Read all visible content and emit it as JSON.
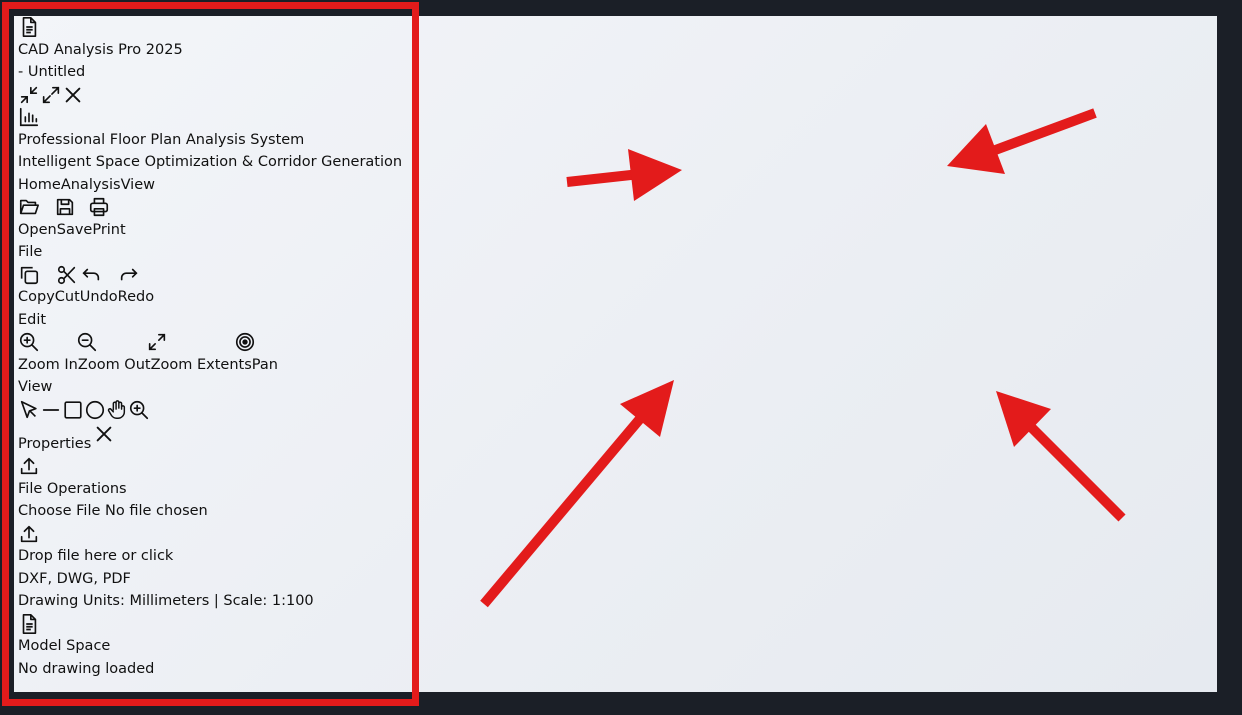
{
  "app": {
    "title": "CAD Analysis Pro 2025",
    "doc_title": "- Untitled"
  },
  "header": {
    "title": "Professional Floor Plan Analysis System",
    "subtitle": "Intelligent Space Optimization & Corridor Generation"
  },
  "tabs": [
    "Home",
    "Analysis",
    "View"
  ],
  "ribbon": {
    "file": {
      "group": "File",
      "buttons": [
        "Open",
        "Save",
        "Print"
      ]
    },
    "edit": {
      "group": "Edit",
      "buttons": [
        "Copy",
        "Cut",
        "Undo",
        "Redo"
      ]
    },
    "view": {
      "group": "View",
      "buttons": [
        "Zoom In",
        "Zoom Out",
        "Zoom Extents",
        "Pan"
      ]
    }
  },
  "tools": [
    "select-icon",
    "line-icon",
    "rectangle-icon",
    "circle-icon",
    "hand-icon",
    "zoom-icon"
  ],
  "properties": {
    "label": "Properties"
  },
  "file_ops": {
    "title": "File Operations",
    "choose_button": "Choose File",
    "no_file": "No file chosen",
    "drop_text": "Drop file here or click",
    "formats": "DXF, DWG, PDF"
  },
  "units": "Drawing Units: Millimeters | Scale: 1:100",
  "model_space": {
    "title": "Model Space",
    "status": "No drawing loaded"
  },
  "colors": {
    "frame": "#1b1f27",
    "canvas": "#eceff4",
    "annotation": "#e31b1b"
  }
}
